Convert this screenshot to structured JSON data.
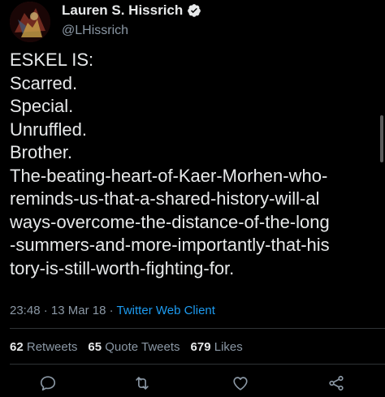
{
  "author": {
    "display_name": "Lauren S. Hissrich",
    "handle": "@LHissrich",
    "verified_icon": "verified-badge-icon",
    "verified_color": "#e7e9ea"
  },
  "tweet": {
    "lines": [
      "ESKEL IS:",
      "Scarred.",
      "Special.",
      "Unruffled.",
      "Brother.",
      "The-beating-heart-of-Kaer-Morhen-who-",
      "reminds-us-that-a-shared-history-will-al",
      "ways-overcome-the-distance-of-the-long",
      "-summers-and-more-importantly-that-his",
      "tory-is-still-worth-fighting-for."
    ],
    "time": "23:48",
    "separator": "·",
    "date": "13 Mar 18",
    "client": "Twitter Web Client"
  },
  "stats": {
    "retweets_count": "62",
    "retweets_label": "Retweets",
    "quotes_count": "65",
    "quotes_label": "Quote Tweets",
    "likes_count": "679",
    "likes_label": "Likes"
  },
  "actions": {
    "reply_icon": "reply-icon",
    "retweet_icon": "retweet-icon",
    "like_icon": "like-icon",
    "share_icon": "share-icon"
  },
  "colors": {
    "background": "#000000",
    "text": "#e7e9ea",
    "secondary": "#8b98a5",
    "link": "#1d9bf0",
    "divider": "#2f3336"
  }
}
